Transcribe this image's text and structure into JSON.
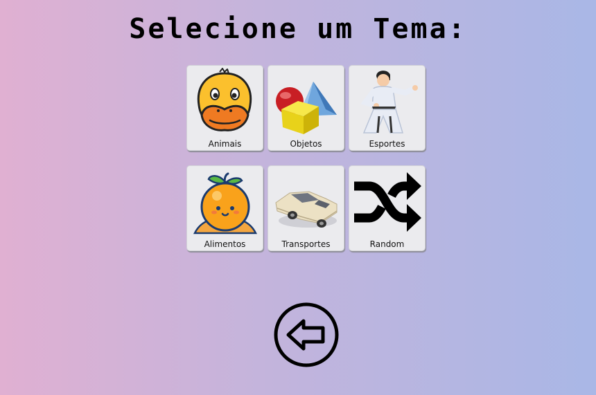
{
  "header": {
    "title": "Selecione um Tema:"
  },
  "themes": [
    {
      "label": "Animais",
      "icon": "duck-icon"
    },
    {
      "label": "Objetos",
      "icon": "shapes-icon"
    },
    {
      "label": "Esportes",
      "icon": "karate-icon"
    },
    {
      "label": "Alimentos",
      "icon": "orange-icon"
    },
    {
      "label": "Transportes",
      "icon": "car-icon"
    },
    {
      "label": "Random",
      "icon": "shuffle-icon"
    }
  ],
  "footer": {
    "back_icon": "back-arrow-icon"
  },
  "colors": {
    "background_start": "#e0b0d2",
    "background_end": "#a9b7e6",
    "card_background": "#ebebee",
    "title_color": "#000000"
  }
}
